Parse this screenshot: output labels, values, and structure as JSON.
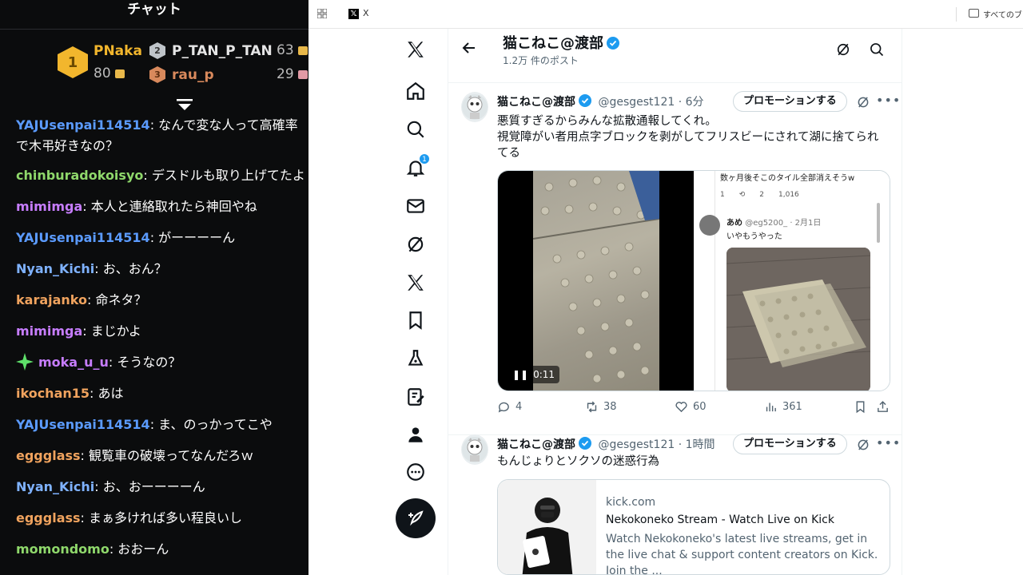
{
  "chat": {
    "title": "チャット",
    "leaderboard": [
      {
        "rank": "1",
        "name": "PNaka",
        "points": "80"
      },
      {
        "rank": "2",
        "name": "P_TAN_P_TAN",
        "points": "63"
      },
      {
        "rank": "3",
        "name": "rau_p",
        "points": "29"
      }
    ],
    "messages": [
      {
        "user": "YAJUsenpai114514",
        "color": "#5b9bff",
        "text": ": なんで変な人って高確率で木弔好きなの？"
      },
      {
        "user": "chinburadokoisyo",
        "color": "#8fd86b",
        "text": ": デスドルも取り上げてたよ"
      },
      {
        "user": "mimimga",
        "color": "#c77dff",
        "text": ": 本人と連絡取れたら神回やね"
      },
      {
        "user": "YAJUsenpai114514",
        "color": "#5b9bff",
        "text": ": がーーーーん"
      },
      {
        "user": "Nyan_Kichi",
        "color": "#7fb2ff",
        "text": ": お、おん？"
      },
      {
        "user": "karajanko",
        "color": "#f0a35e",
        "text": ": 命ネタ？"
      },
      {
        "user": "mimimga",
        "color": "#c77dff",
        "text": ": まじかよ"
      },
      {
        "user": "moka_u_u",
        "color": "#c77dff",
        "text": ": そうなの？"
      },
      {
        "user": "ikochan15",
        "color": "#f0a35e",
        "text": ": あは"
      },
      {
        "user": "YAJUsenpai114514",
        "color": "#5b9bff",
        "text": ": ま、のっかってこや"
      },
      {
        "user": "eggglass",
        "color": "#f0a35e",
        "text": ": 観覧車の破壊ってなんだろｗ"
      },
      {
        "user": "Nyan_Kichi",
        "color": "#7fb2ff",
        "text": ": お、おーーーーん"
      },
      {
        "user": "eggglass",
        "color": "#f0a35e",
        "text": ": まぁ多ければ多い程良いし"
      },
      {
        "user": "momondomo",
        "color": "#8fd86b",
        "text": ": おおーん"
      }
    ]
  },
  "browser": {
    "tab_label": "X",
    "bookmarks_label": "すべてのブ"
  },
  "x": {
    "notification_count": "1",
    "profile_name": "猫こねこ@渡部",
    "profile_posts": "1.2万 件のポスト",
    "tweets": [
      {
        "name": "猫こねこ@渡部",
        "handle": "@gesgest121 · 6分",
        "promo": "プロモーションする",
        "text_line1": "悪質すぎるからみんな拡散通報してくれ。",
        "text_line2": "視覚障がい者用点字ブロックを剥がしてフリスビーにされて湖に捨てられてる",
        "video_time": "0:11",
        "embedded_text1": "数ヶ月後そこのタイル全部消えそうw",
        "embedded_stats": [
          "1",
          "2",
          "1,016"
        ],
        "embedded_user": "あめ",
        "embedded_meta": "@eg5200_ · 2月1日",
        "embedded_text2": "いやもうやった",
        "replies": "4",
        "reposts": "38",
        "likes": "60",
        "views": "361"
      },
      {
        "name": "猫こねこ@渡部",
        "handle": "@gesgest121 · 1時間",
        "promo": "プロモーションする",
        "text": "もんじょりとソクソの迷惑行為",
        "card_domain": "kick.com",
        "card_title": "Nekokoneko Stream - Watch Live on Kick",
        "card_desc": "Watch Nekokoneko's latest live streams, get in the live chat & support content creators on Kick. Join the ..."
      }
    ]
  },
  "colors": {
    "accent": "#1d9bf0",
    "chat_bg": "#0b0c0d",
    "gold": "#f2b62d"
  }
}
